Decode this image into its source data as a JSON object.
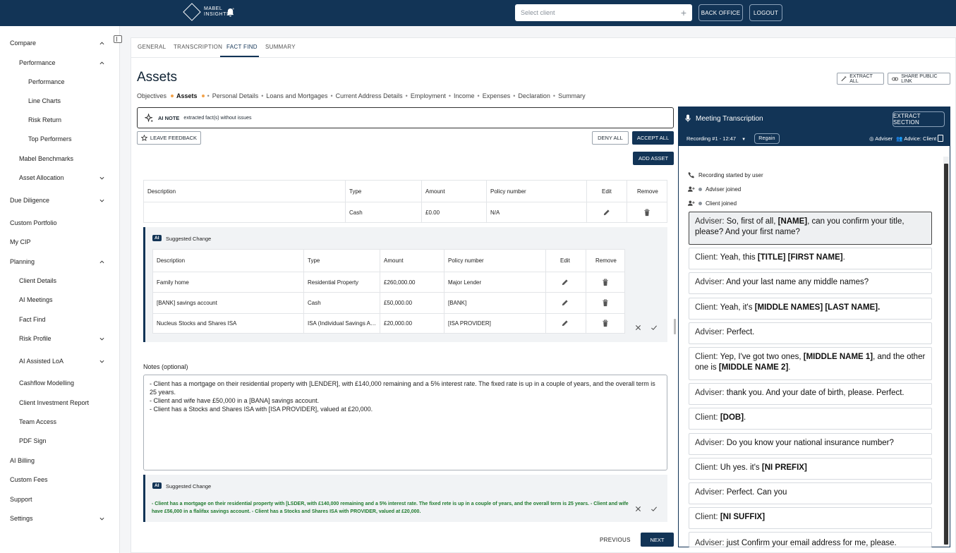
{
  "topbar": {
    "logo_line1": "MABEL",
    "logo_line2": "INSIGHTS",
    "client_placeholder": "Select client",
    "back_office": "BACK OFFICE",
    "logout": "LOGOUT"
  },
  "sidebar": {
    "compare": "Compare",
    "performance_group": "Performance",
    "performance": "Performance",
    "line_charts": "Line Charts",
    "risk_return": "Risk Return",
    "top_performers": "Top Performers",
    "mabel_benchmarks": "Mabel Benchmarks",
    "asset_allocation": "Asset Allocation",
    "due_diligence": "Due Diligence",
    "custom_portfolio": "Custom Portfolio",
    "my_cip": "My CIP",
    "planning": "Planning",
    "client_details": "Client Details",
    "ai_meetings": "AI Meetings",
    "fact_find": "Fact Find",
    "risk_profile": "Risk Profile",
    "ai_assisted_loa": "AI Assisted LoA",
    "cashflow_modelling": "Cashflow Modelling",
    "client_investment_report": "Client Investment Report",
    "team_access": "Team Access",
    "pdf_sign": "PDF Sign",
    "ai_billing": "AI Billing",
    "custom_fees": "Custom Fees",
    "support": "Support",
    "settings": "Settings"
  },
  "tabs": {
    "general": "GENERAL",
    "transcription": "TRANSCRIPTION",
    "fact_find": "FACT FIND",
    "summary": "SUMMARY"
  },
  "page": {
    "title": "Assets",
    "extract_all": "EXTRACT ALL",
    "share_public_link": "SHARE PUBLIC LINK"
  },
  "breadcrumbs": {
    "objectives": "Objectives",
    "assets": "Assets",
    "personal_details": "Personal Details",
    "loans": "Loans and Mortgages",
    "address": "Current Address Details",
    "employment": "Employment",
    "income": "Income",
    "expenses": "Expenses",
    "declaration": "Declaration",
    "summary": "Summary"
  },
  "ai_note": {
    "label": "AI NOTE",
    "text": "extracted fact(s) without issues"
  },
  "actions": {
    "leave_feedback": "LEAVE FEEDBACK",
    "deny_all": "DENY ALL",
    "accept_all": "ACCEPT ALL",
    "add_asset": "ADD ASSET"
  },
  "columns": {
    "description": "Description",
    "type": "Type",
    "amount": "Amount",
    "policy_number": "Policy number",
    "edit": "Edit",
    "remove": "Remove"
  },
  "current_row": {
    "description": "",
    "type": "Cash",
    "amount": "£0.00",
    "policy": "N/A"
  },
  "suggested": {
    "ai_badge": "AI",
    "label": "Suggested Change",
    "rows": [
      {
        "description": "Family home",
        "type": "Residential Property",
        "amount": "£260,000.00",
        "policy": "Major Lender"
      },
      {
        "description": "[BANK] savings account",
        "type": "Cash",
        "amount": "£50,000.00",
        "policy": "[BANK]"
      },
      {
        "description": "Nucleus Stocks and Shares ISA",
        "type": "ISA (Individual Savings Account)",
        "amount": "£20,000.00",
        "policy": "[ISA PROVIDER]"
      }
    ]
  },
  "notes": {
    "label": "Notes (optional)",
    "text": "- Client has a mortgage on their residential property with [LENDER], with £140,000 remaining and a 5% interest rate. The fixed rate is up in a couple of years, and the overall term is 25 years.\n- Client and wife have £50,000 in a [BANA] savings account.\n- Client has a Stocks and Shares ISA with [ISA PROVIDER], valued at £20,000.",
    "suggested_label": "Suggested Change",
    "suggested_text": "- Client has a mortgage on their residential property with [LSDER, with £140,000 remaining and a 5% interest rate. The fixed rete is up in a couple of years, and the overall term is 25 years. - Client and wife have £56,000 in a flalifax savings account. - Client has a Stocks and Shares ISA with PROVIDER, valued at £20,000."
  },
  "footer": {
    "previous": "PREVIOUS",
    "next": "NEXT"
  },
  "transcript": {
    "title": "Meeting Transcription",
    "extract_section": "EXTRACT SECTION",
    "recording": "Recording #1 - 12:47",
    "regain": "Regain",
    "adviser_tag": "Adviser",
    "client_tag": "Advice: Client",
    "events": [
      "Recording started by user",
      "Adviser joined",
      "Client joined"
    ],
    "messages": [
      {
        "speaker": "Adviser:",
        "parts": [
          " So, first of all, ",
          "[NAME]",
          ", can you confirm your title, please? And your first name?"
        ]
      },
      {
        "speaker": "Client:",
        "parts": [
          " Yeah, this ",
          "[TITLE] [FIRST NAME]",
          "."
        ]
      },
      {
        "speaker": "Adviser:",
        "parts": [
          " And your last name any middle names?",
          "",
          ""
        ]
      },
      {
        "speaker": "Client:",
        "parts": [
          " Yeah, it's ",
          "[MIDDLE NAMES] [LAST NAME].",
          ""
        ]
      },
      {
        "speaker": "Adviser:",
        "parts": [
          " Perfect.",
          "",
          ""
        ]
      },
      {
        "speaker": "Client:",
        "parts": [
          " Yep, I've got two ones, ",
          "[MIDDLE NAME 1]",
          ", and the other one is "
        ],
        "tail": "[MIDDLE NAME 2]",
        "tail2": "."
      },
      {
        "speaker": "Adviser:",
        "parts": [
          " thank you. And your date of birth, please. Perfect.",
          "",
          ""
        ]
      },
      {
        "speaker": "Client:",
        "parts": [
          " ",
          "[DOB]",
          "."
        ]
      },
      {
        "speaker": "Adviser:",
        "parts": [
          " Do you know your national insurance number?",
          "",
          ""
        ]
      },
      {
        "speaker": "Client:",
        "parts": [
          " Uh yes. it's ",
          "[NI PREFIX]",
          ""
        ]
      },
      {
        "speaker": "Adviser:",
        "parts": [
          " Perfect. Can you",
          "",
          ""
        ]
      },
      {
        "speaker": "Client:",
        "parts": [
          " ",
          "[NI SUFFIX]",
          ""
        ]
      },
      {
        "speaker": "Adviser:",
        "parts": [
          " just Confirm your email address for me, please.",
          "",
          ""
        ]
      }
    ]
  },
  "colors": {
    "brand": "#123456",
    "accent_dot": "#f2a24a",
    "suggest_green": "#1f7a2e"
  }
}
